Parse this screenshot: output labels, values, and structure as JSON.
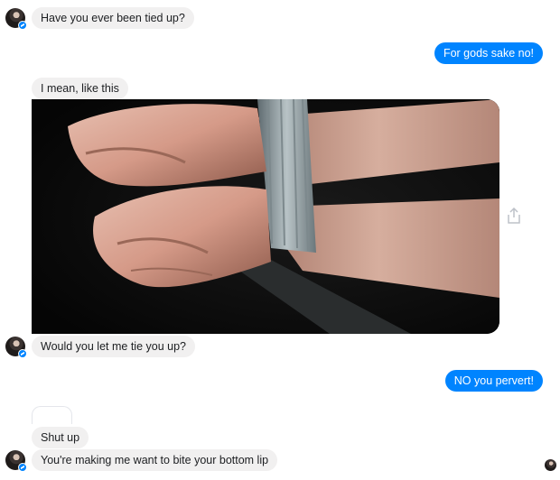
{
  "conversation": {
    "messages": [
      {
        "sender": "them",
        "text": "Have you ever been tied up?"
      },
      {
        "sender": "me",
        "text": "For gods sake no!"
      },
      {
        "sender": "them",
        "text": "I mean, like this"
      },
      {
        "sender": "them",
        "type": "image",
        "icon": "photo-of-bound-wrists"
      },
      {
        "sender": "them",
        "text": "Would you let me tie you up?"
      },
      {
        "sender": "me",
        "text": "NO you pervert!"
      },
      {
        "sender": "them",
        "text": "Shut up"
      },
      {
        "sender": "them",
        "text": "You're making me want to bite your bottom lip"
      }
    ]
  },
  "icons": {
    "avatar": "profile-photo-icon",
    "badge": "messenger-badge-icon",
    "share": "share-icon",
    "seen": "seen-avatar-icon"
  },
  "colors": {
    "outgoing_bubble": "#0084ff",
    "incoming_bubble": "#f1f0f0",
    "text_dark": "#1c1e21"
  }
}
